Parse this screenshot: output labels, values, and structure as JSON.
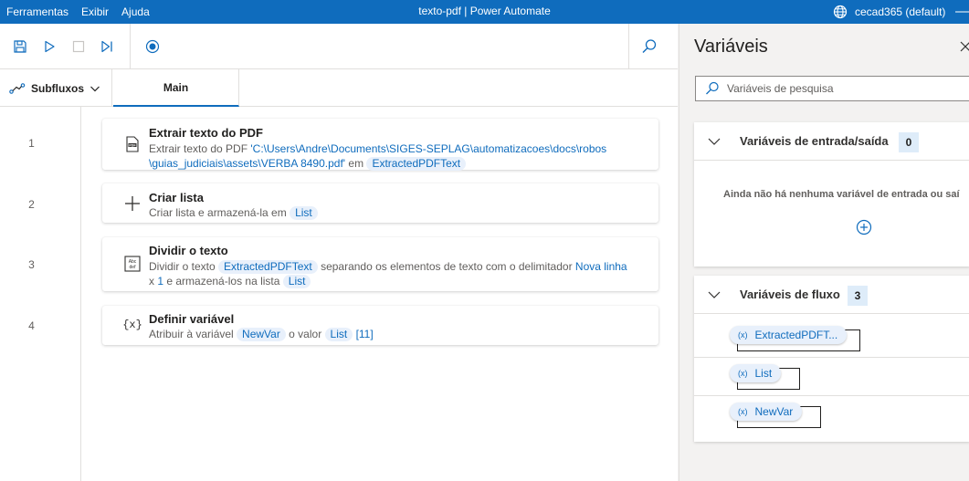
{
  "titlebar": {
    "menu": [
      "Ferramentas",
      "Exibir",
      "Ajuda"
    ],
    "title": "texto-pdf | Power Automate",
    "account": "cecad365 (default)"
  },
  "toolbar": {
    "icons": [
      "save-icon",
      "run-icon",
      "stop-icon",
      "run-next-action-icon",
      "record-icon",
      "search-icon"
    ]
  },
  "tabs": {
    "subflows_label": "Subfluxos",
    "main_label": "Main"
  },
  "actions": [
    {
      "line": "1",
      "icon": "pdf-icon",
      "title": "Extrair texto do PDF",
      "desc_prefix": "Extrair texto do PDF ",
      "path": "'C:\\Users\\Andre\\Documents\\SIGES-SEPLAG\\automatizacoes\\docs\\robos \\guias_judiciais\\assets\\VERBA 8490.pdf'",
      "in_label": " em ",
      "var": "ExtractedPDFText"
    },
    {
      "line": "2",
      "icon": "plus-icon",
      "title": "Criar lista",
      "desc_prefix": "Criar lista e armazená-la em ",
      "var": "List"
    },
    {
      "line": "3",
      "icon": "split-text-icon",
      "title": "Dividir o texto",
      "desc_prefix": "Dividir o texto ",
      "var1": "ExtractedPDFText",
      "mid": " separando os elementos de texto com o delimitador ",
      "delimiter": "Nova linha",
      "x_label": "x ",
      "times": "1",
      "suffix": " e armazená-los na lista ",
      "var2": "List"
    },
    {
      "line": "4",
      "icon": "variable-icon",
      "title": "Definir variável",
      "desc_prefix": "Atribuir à variável ",
      "var1": "NewVar",
      "mid": " o valor ",
      "var2": "List",
      "index": "[11]"
    }
  ],
  "variables_pane": {
    "title": "Variáveis",
    "search_placeholder": "Variáveis de pesquisa",
    "io_section": {
      "label": "Variáveis de entrada/saída",
      "count": "0",
      "empty_message": "Ainda não há nenhuma variável de entrada ou saí"
    },
    "flow_section": {
      "label": "Variáveis de fluxo",
      "count": "3",
      "items": [
        {
          "prefix": "(x)",
          "name": "ExtractedPDFT..."
        },
        {
          "prefix": "(x)",
          "name": "List"
        },
        {
          "prefix": "(x)",
          "name": "NewVar"
        }
      ]
    }
  },
  "colors": {
    "accent": "#0f6cbd",
    "pill_bg": "#e8f0fb",
    "count_bg": "#deecf9"
  }
}
